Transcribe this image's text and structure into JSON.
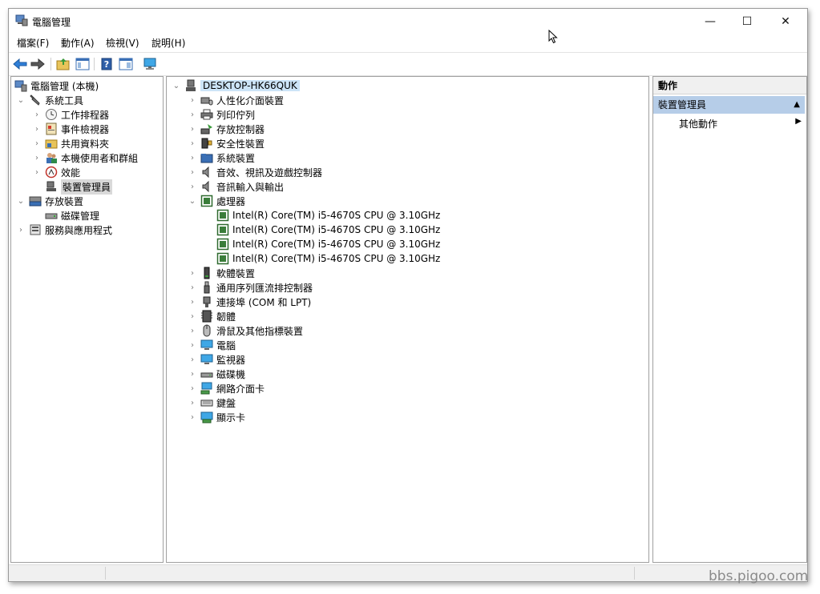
{
  "window": {
    "title": "電腦管理",
    "minimize_glyph": "—",
    "maximize_glyph": "☐",
    "close_glyph": "✕"
  },
  "menu": {
    "items": [
      "檔案(F)",
      "動作(A)",
      "檢視(V)",
      "說明(H)"
    ]
  },
  "toolbar": {
    "icons": [
      "back-arrow-icon",
      "forward-arrow-icon",
      "up-folder-icon",
      "console-tree-icon",
      "help-icon",
      "properties-icon",
      "monitor-icon"
    ]
  },
  "left_tree": {
    "root": "電腦管理 (本機)",
    "items": [
      "系統工具",
      "工作排程器",
      "事件檢視器",
      "共用資料夾",
      "本機使用者和群組",
      "效能",
      "裝置管理員",
      "存放裝置",
      "磁碟管理",
      "服務與應用程式"
    ]
  },
  "device_tree": {
    "root": "DESKTOP-HK66QUK",
    "categories": [
      "人性化介面裝置",
      "列印佇列",
      "存放控制器",
      "安全性裝置",
      "系統裝置",
      "音效、視訊及遊戲控制器",
      "音訊輸入與輸出",
      "處理器",
      "軟體裝置",
      "通用序列匯流排控制器",
      "連接埠 (COM 和 LPT)",
      "韌體",
      "滑鼠及其他指標裝置",
      "電腦",
      "監視器",
      "磁碟機",
      "網路介面卡",
      "鍵盤",
      "顯示卡"
    ],
    "cpus": [
      "Intel(R) Core(TM) i5-4670S CPU @ 3.10GHz",
      "Intel(R) Core(TM) i5-4670S CPU @ 3.10GHz",
      "Intel(R) Core(TM) i5-4670S CPU @ 3.10GHz",
      "Intel(R) Core(TM) i5-4670S CPU @ 3.10GHz"
    ]
  },
  "actions": {
    "header": "動作",
    "section": "裝置管理員",
    "item": "其他動作"
  },
  "watermark": "bbs.pigoo.com",
  "colors": {
    "selection": "#cce4f7",
    "action_section": "#b6cde8",
    "accent_blue": "#1e73be"
  }
}
